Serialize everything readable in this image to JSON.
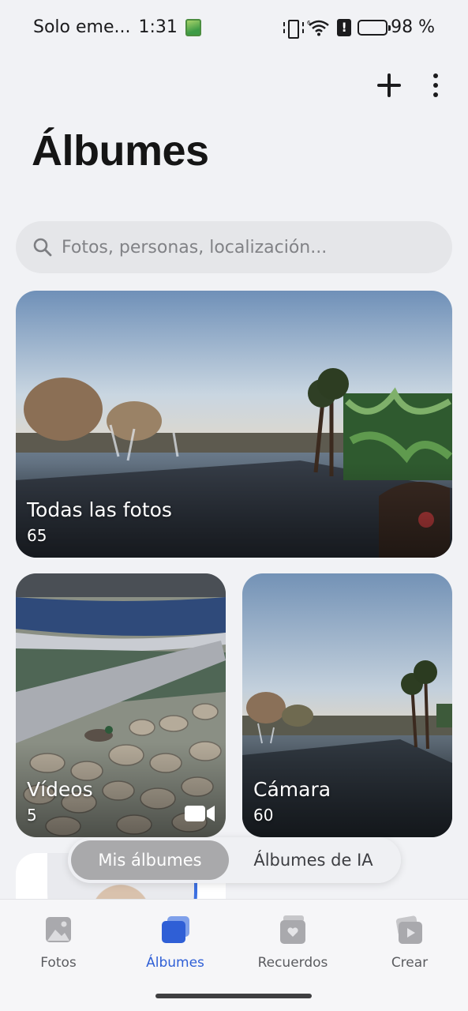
{
  "status_bar": {
    "carrier": "Solo eme...",
    "time": "1:31",
    "battery": "98 %"
  },
  "header": {
    "title": "Álbumes",
    "add_icon": "plus-icon",
    "more_icon": "more-vertical-icon"
  },
  "search": {
    "placeholder": "Fotos, personas, localización..."
  },
  "albums": [
    {
      "name": "Todas las fotos",
      "count": "65"
    },
    {
      "name": "Vídeos",
      "count": "5",
      "icon": "video-camera-icon"
    },
    {
      "name": "Cámara",
      "count": "60"
    }
  ],
  "segmented": {
    "items": [
      {
        "label": "Mis álbumes",
        "active": true
      },
      {
        "label": "Álbumes de IA",
        "active": false
      }
    ]
  },
  "bottom_nav": {
    "items": [
      {
        "label": "Fotos",
        "icon": "photo-icon"
      },
      {
        "label": "Álbumes",
        "icon": "albums-icon",
        "active": true
      },
      {
        "label": "Recuerdos",
        "icon": "memories-icon"
      },
      {
        "label": "Crear",
        "icon": "create-icon"
      }
    ]
  },
  "colors": {
    "accent": "#2f5fd6",
    "background": "#f1f2f5"
  }
}
